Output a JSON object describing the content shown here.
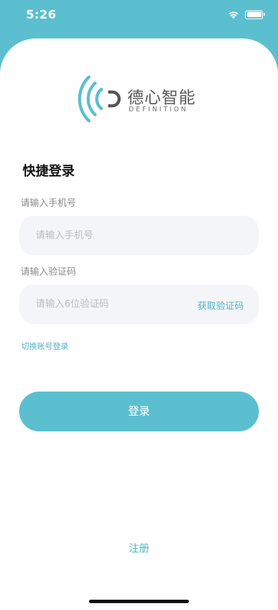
{
  "status_bar": {
    "time": "5:26"
  },
  "logo": {
    "name_cn": "德心智能",
    "name_en": "DEFINITION"
  },
  "login": {
    "title": "快捷登录",
    "phone_label": "请输入手机号",
    "phone_placeholder": "请输入手机号",
    "code_label": "请输入验证码",
    "code_placeholder": "请输入6位验证码",
    "get_code": "获取验证码",
    "switch_account": "切换账号登录",
    "submit": "登录",
    "register": "注册"
  },
  "colors": {
    "accent": "#5bbfcf",
    "link": "#4fb3c6",
    "input_bg": "#f4f5f8"
  }
}
